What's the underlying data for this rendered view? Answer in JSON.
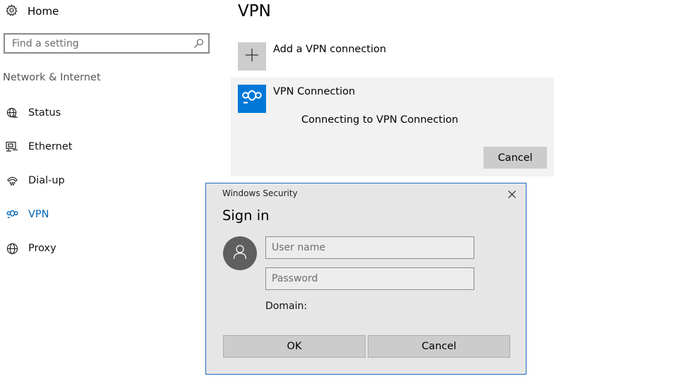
{
  "sidebar": {
    "home_label": "Home",
    "search": {
      "placeholder": "Find a setting"
    },
    "section_heading": "Network & Internet",
    "items": [
      {
        "label": "Status",
        "icon": "globe-status-icon"
      },
      {
        "label": "Ethernet",
        "icon": "ethernet-icon"
      },
      {
        "label": "Dial-up",
        "icon": "dial-up-icon"
      },
      {
        "label": "VPN",
        "icon": "vpn-icon",
        "active": true
      },
      {
        "label": "Proxy",
        "icon": "globe-icon"
      }
    ],
    "active_color": "#0063b1"
  },
  "main": {
    "title": "VPN",
    "add_connection_label": "Add a VPN connection",
    "connection": {
      "name": "VPN Connection",
      "status": "Connecting to VPN Connection",
      "cancel_label": "Cancel",
      "tile_color": "#0078d7"
    }
  },
  "dialog": {
    "window_title": "Windows Security",
    "heading": "Sign in",
    "username_placeholder": "User name",
    "password_placeholder": "Password",
    "domain_label": "Domain:",
    "ok_label": "OK",
    "cancel_label": "Cancel"
  }
}
